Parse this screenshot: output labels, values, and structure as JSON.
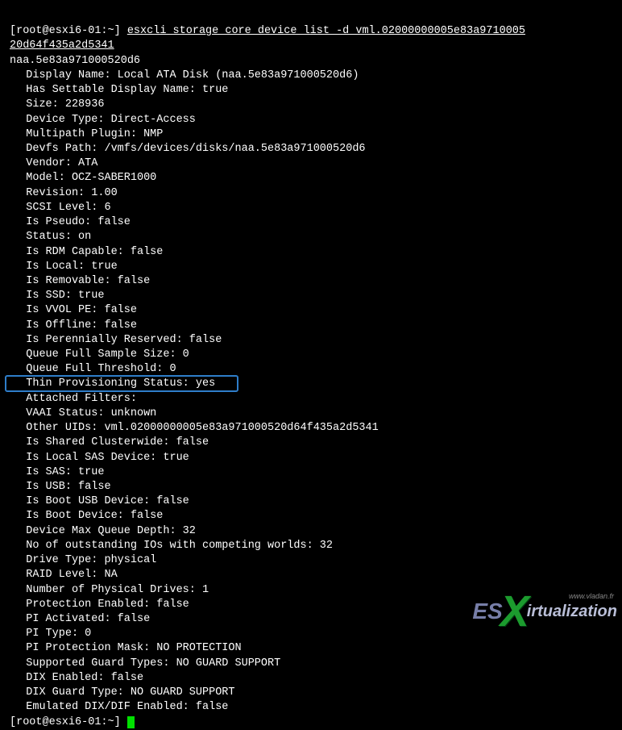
{
  "prompt1": "[root@esxi6-01:~] ",
  "command": "esxcli storage core device list -d vml.02000000005e83a9710005",
  "command_wrap": "20d64f435a2d5341",
  "device_id": "naa.5e83a971000520d6",
  "fields": [
    "Display Name: Local ATA Disk (naa.5e83a971000520d6)",
    "Has Settable Display Name: true",
    "Size: 228936",
    "Device Type: Direct-Access",
    "Multipath Plugin: NMP",
    "Devfs Path: /vmfs/devices/disks/naa.5e83a971000520d6",
    "Vendor: ATA",
    "Model: OCZ-SABER1000",
    "Revision: 1.00",
    "SCSI Level: 6",
    "Is Pseudo: false",
    "Status: on",
    "Is RDM Capable: false",
    "Is Local: true",
    "Is Removable: false",
    "Is SSD: true",
    "Is VVOL PE: false",
    "Is Offline: false",
    "Is Perennially Reserved: false",
    "Queue Full Sample Size: 0",
    "Queue Full Threshold: 0",
    "Thin Provisioning Status: yes",
    "Attached Filters:",
    "VAAI Status: unknown",
    "Other UIDs: vml.02000000005e83a971000520d64f435a2d5341",
    "Is Shared Clusterwide: false",
    "Is Local SAS Device: true",
    "Is SAS: true",
    "Is USB: false",
    "Is Boot USB Device: false",
    "Is Boot Device: false",
    "Device Max Queue Depth: 32",
    "No of outstanding IOs with competing worlds: 32",
    "Drive Type: physical",
    "RAID Level: NA",
    "Number of Physical Drives: 1",
    "Protection Enabled: false",
    "PI Activated: false",
    "PI Type: 0",
    "PI Protection Mask: NO PROTECTION",
    "Supported Guard Types: NO GUARD SUPPORT",
    "DIX Enabled: false",
    "DIX Guard Type: NO GUARD SUPPORT",
    "Emulated DIX/DIF Enabled: false"
  ],
  "prompt2": "[root@esxi6-01:~] ",
  "watermark": {
    "es": "ES",
    "rest": "irtualization",
    "url": "www.vladan.fr"
  }
}
